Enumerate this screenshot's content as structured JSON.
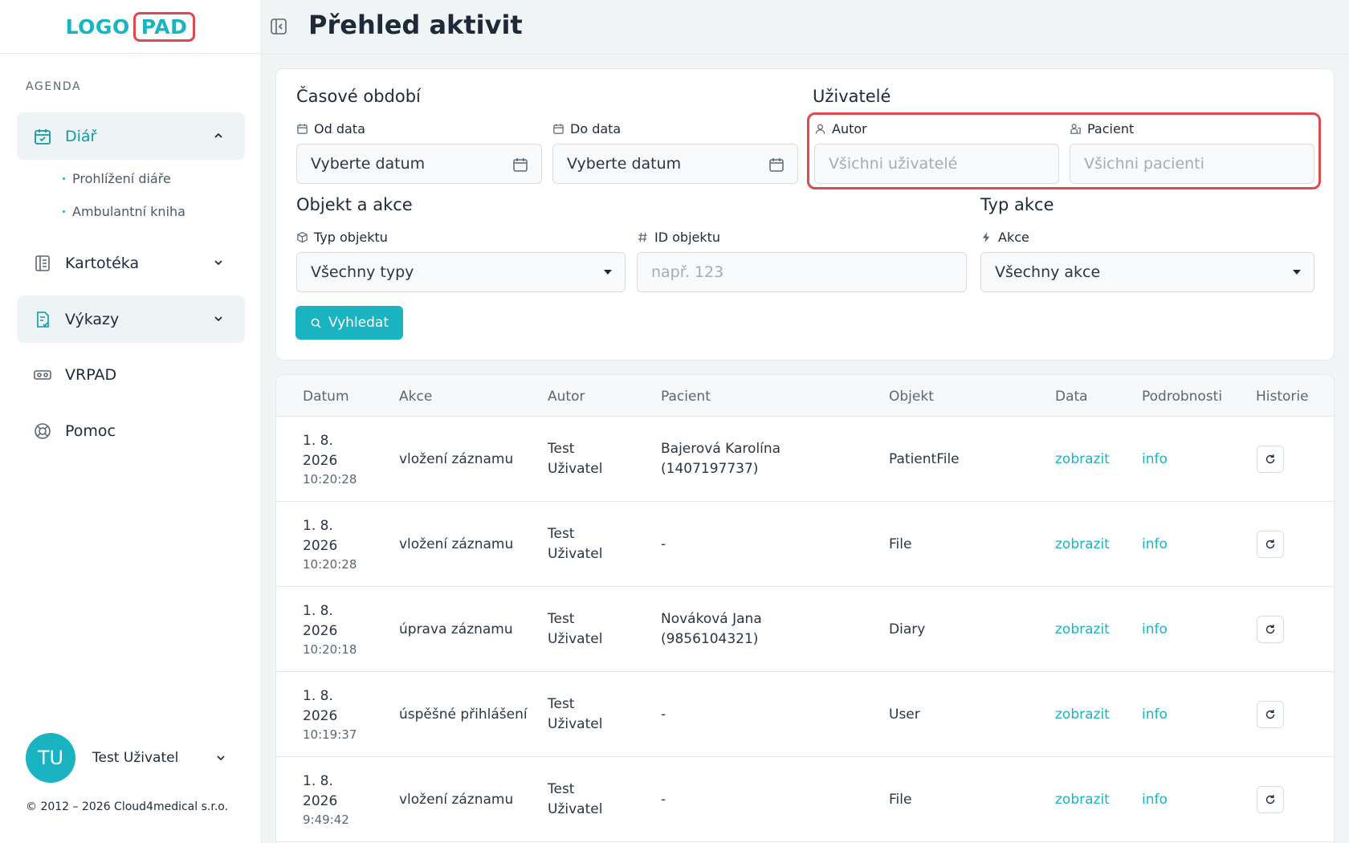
{
  "logo": {
    "part1": "LOGO",
    "part2": "PAD"
  },
  "sidebar": {
    "section_label": "AGENDA",
    "items": [
      {
        "label": "Diář",
        "icon": "calendar-check-icon",
        "expanded": true
      },
      {
        "label": "Kartotéka",
        "icon": "book-icon"
      },
      {
        "label": "Výkazy",
        "icon": "report-icon"
      },
      {
        "label": "VRPAD",
        "icon": "vr-headset-icon"
      },
      {
        "label": "Pomoc",
        "icon": "lifebuoy-icon"
      }
    ],
    "subitems": [
      "Prohlížení diáře",
      "Ambulantní kniha"
    ]
  },
  "user": {
    "initials": "TU",
    "name": "Test Uživatel"
  },
  "copyright": "© 2012 – 2026 Cloud4medical s.r.o.",
  "header": {
    "title": "Přehled aktivit"
  },
  "filters": {
    "period": {
      "title": "Časové období",
      "from_label": "Od data",
      "from_value": "Vyberte datum",
      "to_label": "Do data",
      "to_value": "Vyberte datum"
    },
    "users": {
      "title": "Uživatelé",
      "author_label": "Autor",
      "author_placeholder": "Všichni uživatelé",
      "patient_label": "Pacient",
      "patient_placeholder": "Všichni pacienti"
    },
    "object": {
      "title": "Objekt a akce",
      "type_label": "Typ objektu",
      "type_value": "Všechny typy",
      "id_label": "ID objektu",
      "id_placeholder": "např. 123"
    },
    "action": {
      "title": "Typ akce",
      "action_label": "Akce",
      "action_value": "Všechny akce"
    },
    "search_button": "Vyhledat"
  },
  "table": {
    "headers": [
      "Datum",
      "Akce",
      "Autor",
      "Pacient",
      "Objekt",
      "Data",
      "Podrobnosti",
      "Historie"
    ],
    "rows": [
      {
        "date1": "1. 8.",
        "date2": "2026",
        "time": "10:20:28",
        "action": "vložení záznamu",
        "author1": "Test",
        "author2": "Uživatel",
        "patient1": "Bajerová Karolína",
        "patient2": "(1407197737)",
        "object": "PatientFile",
        "data": "zobrazit",
        "details": "info"
      },
      {
        "date1": "1. 8.",
        "date2": "2026",
        "time": "10:20:28",
        "action": "vložení záznamu",
        "author1": "Test",
        "author2": "Uživatel",
        "patient1": "-",
        "patient2": "",
        "object": "File",
        "data": "zobrazit",
        "details": "info"
      },
      {
        "date1": "1. 8.",
        "date2": "2026",
        "time": "10:20:18",
        "action": "úprava záznamu",
        "author1": "Test",
        "author2": "Uživatel",
        "patient1": "Nováková Jana",
        "patient2": "(9856104321)",
        "object": "Diary",
        "data": "zobrazit",
        "details": "info"
      },
      {
        "date1": "1. 8.",
        "date2": "2026",
        "time": "10:19:37",
        "action": "úspěšné přihlášení",
        "author1": "Test",
        "author2": "Uživatel",
        "patient1": "-",
        "patient2": "",
        "object": "User",
        "data": "zobrazit",
        "details": "info"
      },
      {
        "date1": "1. 8.",
        "date2": "2026",
        "time": "9:49:42",
        "action": "vložení záznamu",
        "author1": "Test",
        "author2": "Uživatel",
        "patient1": "-",
        "patient2": "",
        "object": "File",
        "data": "zobrazit",
        "details": "info"
      }
    ]
  },
  "colors": {
    "accent": "#19b3c1",
    "highlight": "#e0494b",
    "text": "#1e2a3a"
  }
}
